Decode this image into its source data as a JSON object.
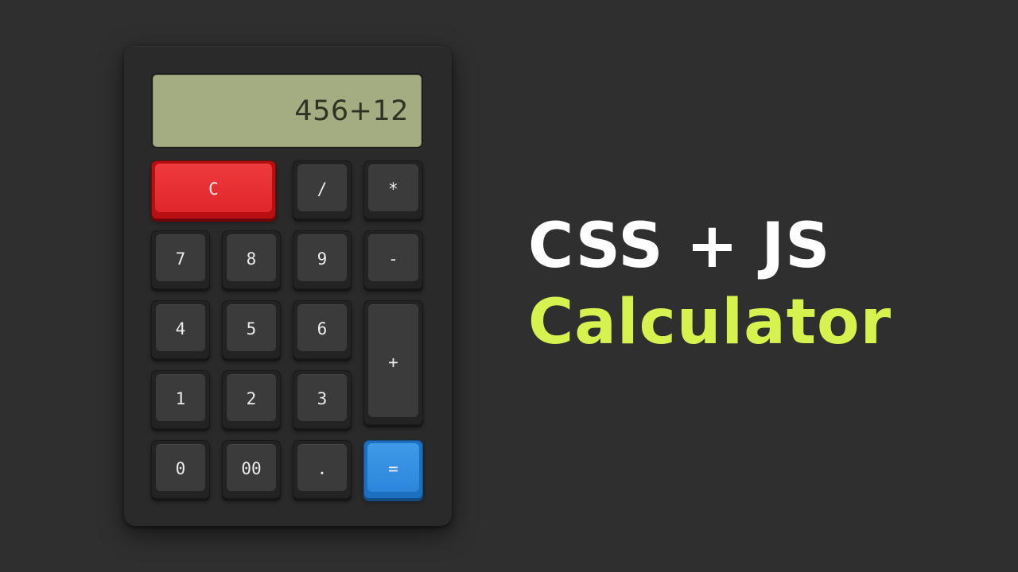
{
  "display": {
    "value": "456+12"
  },
  "keys": {
    "clear": "C",
    "divide": "/",
    "multiply": "*",
    "seven": "7",
    "eight": "8",
    "nine": "9",
    "minus": "-",
    "four": "4",
    "five": "5",
    "six": "6",
    "plus": "+",
    "one": "1",
    "two": "2",
    "three": "3",
    "zero": "0",
    "double_zero": "00",
    "decimal": ".",
    "equals": "="
  },
  "headline": {
    "line1": "CSS + JS",
    "line2": "Calculator"
  },
  "colors": {
    "background": "#2f2f2f",
    "display": "#a4ad82",
    "clear_key": "#e0262a",
    "equals_key": "#2d86dc",
    "headline_accent": "#d6f24f"
  }
}
